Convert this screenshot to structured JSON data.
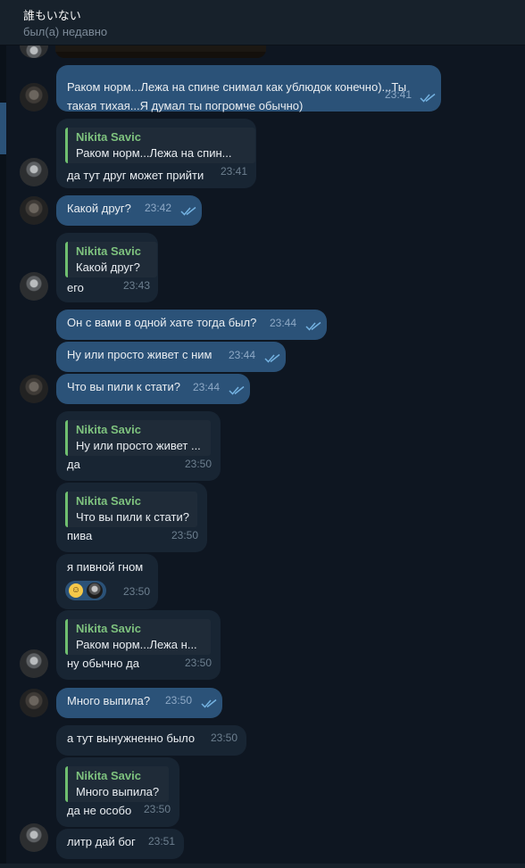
{
  "chat": {
    "title": "誰もいない",
    "status": "был(а) недавно"
  },
  "messages": [
    {
      "id": "m1",
      "dir": "out",
      "text": [
        "Раком норм...Лежа на спине снимал как ублюдок конечно)...Ты",
        "такая тихая...Я думал ты погромче обычно)"
      ],
      "time": "23:41",
      "read": true
    },
    {
      "id": "m2",
      "dir": "in",
      "reply": {
        "name": "Nikita Savic",
        "text": "Раком норм...Лежа на спин..."
      },
      "text": [
        "да тут друг может прийти"
      ],
      "time": "23:41"
    },
    {
      "id": "m3",
      "dir": "out",
      "text": [
        "Какой друг?"
      ],
      "time": "23:42",
      "read": true
    },
    {
      "id": "m4",
      "dir": "in",
      "reply": {
        "name": "Nikita Savic",
        "text": "Какой друг?"
      },
      "text": [
        "его"
      ],
      "time": "23:43"
    },
    {
      "id": "m5",
      "dir": "out",
      "text": [
        "Он с вами в одной хате тогда был?"
      ],
      "time": "23:44",
      "read": true
    },
    {
      "id": "m6",
      "dir": "out",
      "text": [
        "Ну или просто живет с ним"
      ],
      "time": "23:44",
      "read": true
    },
    {
      "id": "m7",
      "dir": "out",
      "text": [
        "Что вы пили к стати?"
      ],
      "time": "23:44",
      "read": true
    },
    {
      "id": "m8",
      "dir": "in",
      "reply": {
        "name": "Nikita Savic",
        "text": "Ну или просто живет ..."
      },
      "text": [
        "да"
      ],
      "time": "23:50"
    },
    {
      "id": "m9",
      "dir": "in",
      "reply": {
        "name": "Nikita Savic",
        "text": "Что вы пили к стати?"
      },
      "text": [
        "пива"
      ],
      "time": "23:50"
    },
    {
      "id": "m10",
      "dir": "in",
      "text": [
        "я пивной гном"
      ],
      "time": "23:50",
      "reaction": "😄"
    },
    {
      "id": "m11",
      "dir": "in",
      "reply": {
        "name": "Nikita Savic",
        "text": "Раком норм...Лежа н..."
      },
      "text": [
        "ну обычно да"
      ],
      "time": "23:50"
    },
    {
      "id": "m12",
      "dir": "out",
      "text": [
        "Много выпила?"
      ],
      "time": "23:50",
      "read": true
    },
    {
      "id": "m13",
      "dir": "in",
      "text": [
        "а тут вынужненно было"
      ],
      "time": "23:50"
    },
    {
      "id": "m14",
      "dir": "in",
      "reply": {
        "name": "Nikita Savic",
        "text": "Много выпила?"
      },
      "text": [
        "да не особо"
      ],
      "time": "23:50"
    },
    {
      "id": "m15",
      "dir": "in",
      "text": [
        "литр дай бог"
      ],
      "time": "23:51"
    }
  ],
  "colors": {
    "background": "#0e1621",
    "incoming_bubble": "#182533",
    "outgoing_bubble": "#2b5278",
    "reply_name": "#7ec27e",
    "read_check": "#73b1e0"
  }
}
